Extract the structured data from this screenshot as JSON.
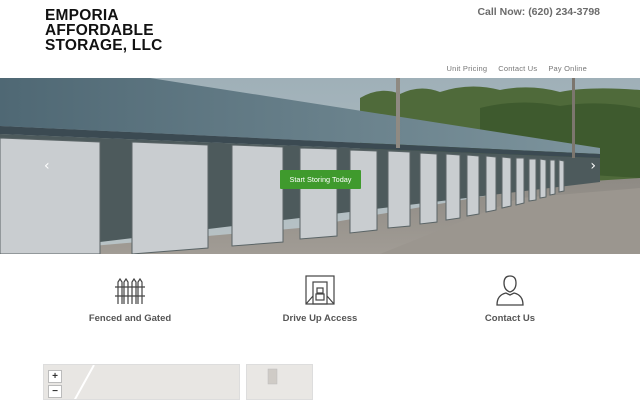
{
  "header": {
    "logo_lines": [
      "EMPORIA",
      "AFFORDABLE",
      "STORAGE, LLC"
    ],
    "phone": "Call Now: (620) 234-3798"
  },
  "nav": {
    "items": [
      "Unit Pricing",
      "Contact Us",
      "Pay Online"
    ]
  },
  "hero": {
    "cta_label": "Start Storing Today",
    "prev_glyph": "‹",
    "next_glyph": "›"
  },
  "features": [
    {
      "label": "Fenced and Gated",
      "icon": "fence-icon"
    },
    {
      "label": "Drive Up Access",
      "icon": "storage-unit-icon"
    },
    {
      "label": "Contact Us",
      "icon": "person-icon"
    }
  ],
  "map": {
    "zoom_in": "+",
    "zoom_out": "−"
  },
  "colors": {
    "cta": "#3f9a2d",
    "roof": "#5e7580"
  }
}
